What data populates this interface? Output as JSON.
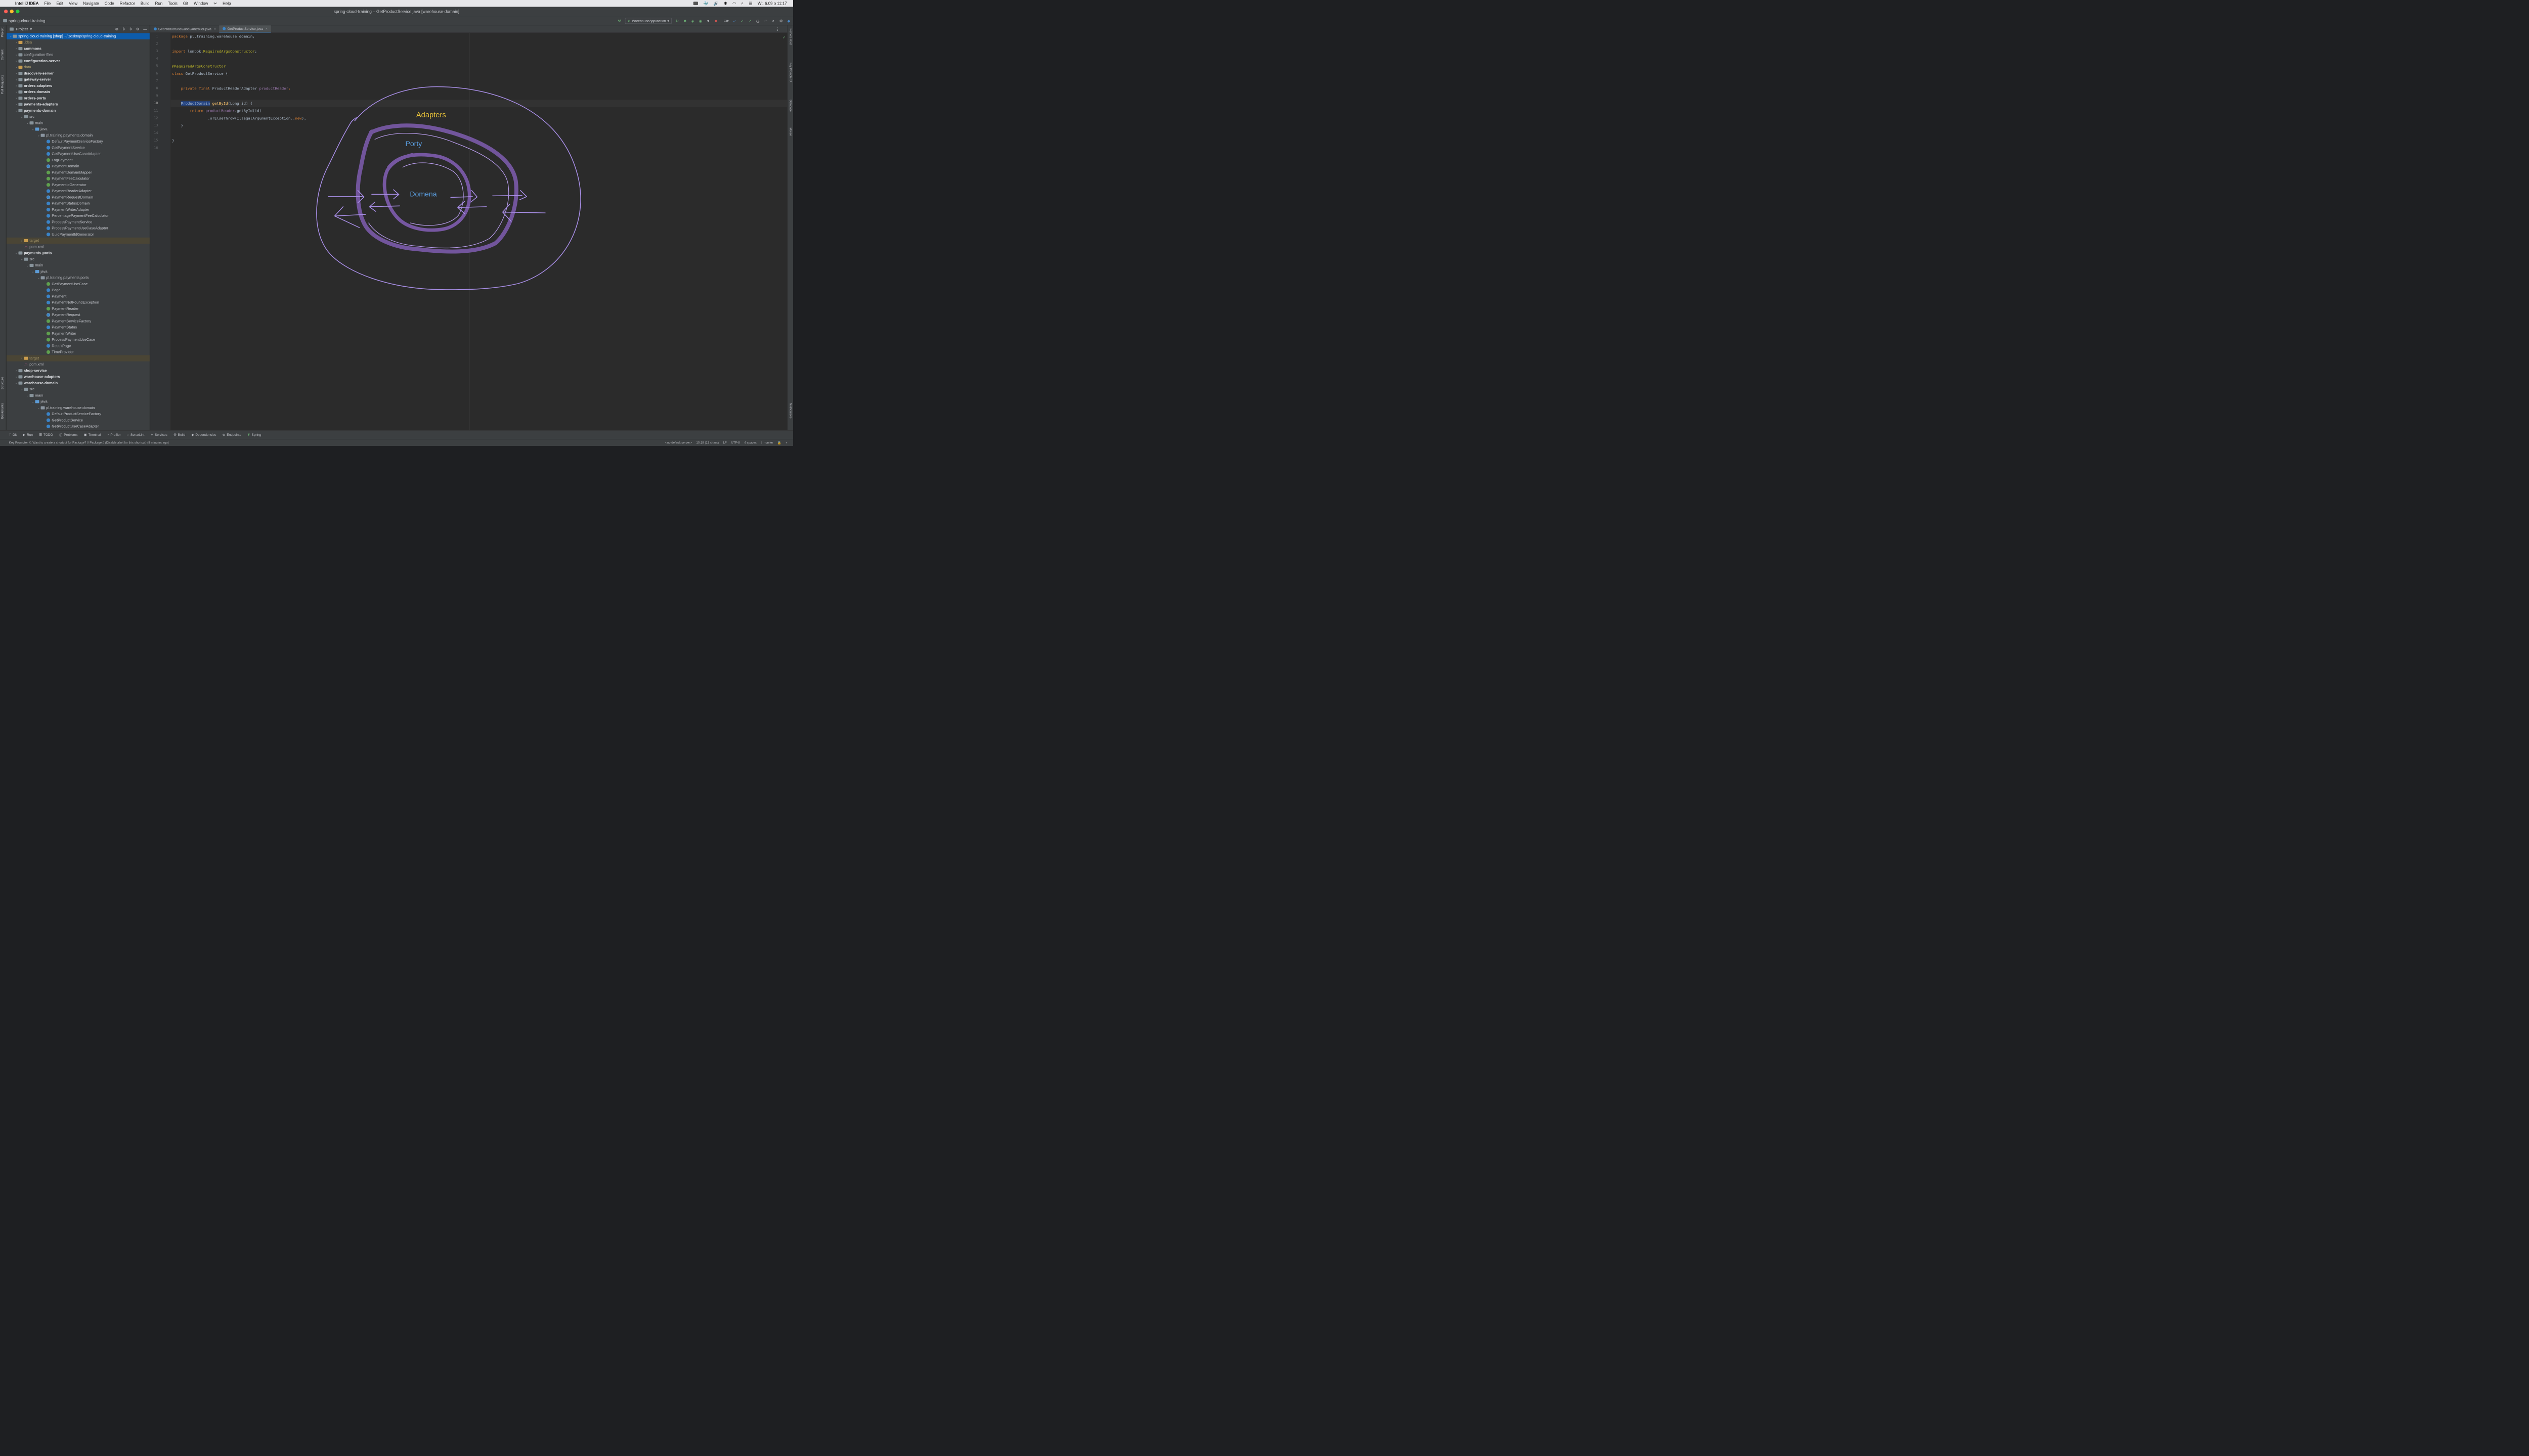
{
  "menubar": {
    "app": "IntelliJ IDEA",
    "items": [
      "File",
      "Edit",
      "View",
      "Navigate",
      "Code",
      "Refactor",
      "Build",
      "Run",
      "Tools",
      "Git",
      "Window",
      "Help"
    ],
    "clock": "Wt. 6.09 o 11:17"
  },
  "window": {
    "title": "spring-cloud-training – GetProductService.java [warehouse-domain]"
  },
  "navbar": {
    "breadcrumb": "spring-cloud-training",
    "run_config": "WarehouseApplication",
    "git_label": "Git:"
  },
  "left_strip": {
    "project": "Project",
    "commit": "Commit",
    "pull_requests": "Pull Requests",
    "structure": "Structure",
    "bookmarks": "Bookmarks"
  },
  "right_strip": {
    "remote_host": "Remote Host",
    "key_promoter": "Key Promoter X",
    "database": "Database",
    "maven": "Maven",
    "notifications": "Notifications"
  },
  "project_panel": {
    "title": "Project",
    "tree": [
      {
        "depth": 0,
        "kind": "module",
        "label": "spring-cloud-training [shop]",
        "path": "~/Desktop/spring-cloud-training",
        "expanded": true,
        "selected": true
      },
      {
        "depth": 1,
        "kind": "folder-orange",
        "label": ".idea",
        "expanded": false
      },
      {
        "depth": 1,
        "kind": "module",
        "label": "commons",
        "expanded": false,
        "bold": true
      },
      {
        "depth": 1,
        "kind": "folder",
        "label": "configuration-files",
        "expanded": false
      },
      {
        "depth": 1,
        "kind": "module",
        "label": "configuration-server",
        "expanded": false,
        "bold": true
      },
      {
        "depth": 1,
        "kind": "folder-orange",
        "label": "data",
        "expanded": false
      },
      {
        "depth": 1,
        "kind": "module",
        "label": "discovery-server",
        "expanded": false,
        "bold": true
      },
      {
        "depth": 1,
        "kind": "module",
        "label": "gateway-server",
        "expanded": false,
        "bold": true
      },
      {
        "depth": 1,
        "kind": "module",
        "label": "orders-adapters",
        "expanded": false,
        "bold": true
      },
      {
        "depth": 1,
        "kind": "module",
        "label": "orders-domain",
        "expanded": false,
        "bold": true
      },
      {
        "depth": 1,
        "kind": "module",
        "label": "orders-ports",
        "expanded": false,
        "bold": true
      },
      {
        "depth": 1,
        "kind": "module",
        "label": "payments-adapters",
        "expanded": false,
        "bold": true
      },
      {
        "depth": 1,
        "kind": "module",
        "label": "payments-domain",
        "expanded": true,
        "bold": true
      },
      {
        "depth": 2,
        "kind": "folder",
        "label": "src",
        "expanded": true
      },
      {
        "depth": 3,
        "kind": "folder",
        "label": "main",
        "expanded": true
      },
      {
        "depth": 4,
        "kind": "folder-blue",
        "label": "java",
        "expanded": true
      },
      {
        "depth": 5,
        "kind": "package",
        "label": "pl.training.payments.domain",
        "expanded": true
      },
      {
        "depth": 6,
        "kind": "class",
        "label": "DefaultPaymentServiceFactory"
      },
      {
        "depth": 6,
        "kind": "class",
        "label": "GetPaymentService"
      },
      {
        "depth": 6,
        "kind": "class",
        "label": "GetPaymentUseCaseAdapter"
      },
      {
        "depth": 6,
        "kind": "interface",
        "label": "LogPayment"
      },
      {
        "depth": 6,
        "kind": "record",
        "label": "PaymentDomain"
      },
      {
        "depth": 6,
        "kind": "interface",
        "label": "PaymentDomainMapper"
      },
      {
        "depth": 6,
        "kind": "interface",
        "label": "PaymentFeeCalculator"
      },
      {
        "depth": 6,
        "kind": "interface",
        "label": "PaymentIdGenerator"
      },
      {
        "depth": 6,
        "kind": "class",
        "label": "PaymentReaderAdapter"
      },
      {
        "depth": 6,
        "kind": "record",
        "label": "PaymentRequestDomain"
      },
      {
        "depth": 6,
        "kind": "class",
        "label": "PaymentStatusDomain"
      },
      {
        "depth": 6,
        "kind": "class",
        "label": "PaymentWriterAdapter"
      },
      {
        "depth": 6,
        "kind": "class",
        "label": "PercentagePaymentFeeCalculator"
      },
      {
        "depth": 6,
        "kind": "class",
        "label": "ProcessPaymentService"
      },
      {
        "depth": 6,
        "kind": "class",
        "label": "ProcessPaymentUseCaseAdapter"
      },
      {
        "depth": 6,
        "kind": "class",
        "label": "UuidPaymentIdGenerator"
      },
      {
        "depth": 2,
        "kind": "folder-orange",
        "label": "target",
        "expanded": false,
        "excluded": true
      },
      {
        "depth": 2,
        "kind": "maven",
        "label": "pom.xml"
      },
      {
        "depth": 1,
        "kind": "module",
        "label": "payments-ports",
        "expanded": true,
        "bold": true
      },
      {
        "depth": 2,
        "kind": "folder",
        "label": "src",
        "expanded": true
      },
      {
        "depth": 3,
        "kind": "folder",
        "label": "main",
        "expanded": true
      },
      {
        "depth": 4,
        "kind": "folder-blue",
        "label": "java",
        "expanded": true
      },
      {
        "depth": 5,
        "kind": "package",
        "label": "pl.training.payments.ports",
        "expanded": true
      },
      {
        "depth": 6,
        "kind": "interface",
        "label": "GetPaymentUseCase"
      },
      {
        "depth": 6,
        "kind": "class",
        "label": "Page"
      },
      {
        "depth": 6,
        "kind": "class",
        "label": "Payment"
      },
      {
        "depth": 6,
        "kind": "class",
        "label": "PaymentNotFoundException"
      },
      {
        "depth": 6,
        "kind": "interface",
        "label": "PaymentReader"
      },
      {
        "depth": 6,
        "kind": "record",
        "label": "PaymentRequest"
      },
      {
        "depth": 6,
        "kind": "interface",
        "label": "PaymentServiceFactory"
      },
      {
        "depth": 6,
        "kind": "class",
        "label": "PaymentStatus"
      },
      {
        "depth": 6,
        "kind": "interface",
        "label": "PaymentWriter"
      },
      {
        "depth": 6,
        "kind": "interface",
        "label": "ProcessPaymentUseCase"
      },
      {
        "depth": 6,
        "kind": "class",
        "label": "ResultPage"
      },
      {
        "depth": 6,
        "kind": "interface",
        "label": "TimeProvider"
      },
      {
        "depth": 2,
        "kind": "folder-orange",
        "label": "target",
        "expanded": false,
        "excluded": true
      },
      {
        "depth": 2,
        "kind": "maven",
        "label": "pom.xml"
      },
      {
        "depth": 1,
        "kind": "module",
        "label": "shop-service",
        "expanded": false,
        "bold": true
      },
      {
        "depth": 1,
        "kind": "module",
        "label": "warehouse-adapters",
        "expanded": false,
        "bold": true
      },
      {
        "depth": 1,
        "kind": "module",
        "label": "warehouse-domain",
        "expanded": true,
        "bold": true
      },
      {
        "depth": 2,
        "kind": "folder",
        "label": "src",
        "expanded": true
      },
      {
        "depth": 3,
        "kind": "folder",
        "label": "main",
        "expanded": true
      },
      {
        "depth": 4,
        "kind": "folder-blue",
        "label": "java",
        "expanded": true
      },
      {
        "depth": 5,
        "kind": "package",
        "label": "pl.training.warehouse.domain",
        "expanded": true
      },
      {
        "depth": 6,
        "kind": "class",
        "label": "DefaultProductServiceFactory"
      },
      {
        "depth": 6,
        "kind": "class",
        "label": "GetProductService"
      },
      {
        "depth": 6,
        "kind": "class",
        "label": "GetProductUseCaseAdapter"
      },
      {
        "depth": 6,
        "kind": "record",
        "label": "ProductDomain"
      }
    ]
  },
  "tabs": [
    {
      "label": "GetProductUseCaseController.java",
      "active": false
    },
    {
      "label": "GetProductService.java",
      "active": true
    }
  ],
  "editor": {
    "current_line": 10,
    "lines": [
      [
        {
          "t": "package ",
          "c": "kw"
        },
        {
          "t": "pl.training.warehouse.domain;"
        }
      ],
      [],
      [
        {
          "t": "import ",
          "c": "kw"
        },
        {
          "t": "lombok."
        },
        {
          "t": "RequiredArgsConstructor",
          "c": "ann"
        },
        {
          "t": ";"
        }
      ],
      [],
      [
        {
          "t": "@RequiredArgsConstructor",
          "c": "ann"
        }
      ],
      [
        {
          "t": "class ",
          "c": "kw"
        },
        {
          "t": "GetProductService {"
        }
      ],
      [],
      [
        {
          "t": "    "
        },
        {
          "t": "private final ",
          "c": "kw"
        },
        {
          "t": "ProductReaderAdapter "
        },
        {
          "t": "productReader",
          "c": "fld"
        },
        {
          "t": ";",
          "c": "kw"
        }
      ],
      [],
      [
        {
          "t": "    "
        },
        {
          "t": "ProductDomain",
          "c": "hl"
        },
        {
          "t": " "
        },
        {
          "t": "getById",
          "c": "fn"
        },
        {
          "t": "(Long id) {"
        }
      ],
      [
        {
          "t": "        "
        },
        {
          "t": "return ",
          "c": "kw"
        },
        {
          "t": "productReader",
          "c": "fld"
        },
        {
          "t": ".getById(id)"
        }
      ],
      [
        {
          "t": "                "
        },
        {
          "t": ".orElseThrow(IllegalArgumentException::"
        },
        {
          "t": "new",
          "c": "kw"
        },
        {
          "t": ");"
        }
      ],
      [
        {
          "t": "    }"
        }
      ],
      [],
      [
        {
          "t": "}"
        }
      ],
      []
    ]
  },
  "drawing": {
    "outer_label": "Adapters",
    "middle_label": "Porty",
    "inner_label": "Domena",
    "colors": {
      "stroke": "#9b7fd6",
      "thick": "#7a5aa8",
      "yellow": "#e8c23a",
      "blue": "#5a9ee0"
    }
  },
  "bottom_toolbar": [
    "Git",
    "Run",
    "TODO",
    "Problems",
    "Terminal",
    "Profiler",
    "SonarLint",
    "Services",
    "Build",
    "Dependencies",
    "Endpoints",
    "Spring"
  ],
  "statusbar": {
    "message": "Key Promoter X: Want to create a shortcut for Package? // Package // (Disable alert for this shortcut) (8 minutes ago)",
    "server": "<no default server>",
    "position": "10:18 (13 chars)",
    "line_sep": "LF",
    "encoding": "UTF-8",
    "indent": "4 spaces",
    "branch": "master"
  }
}
